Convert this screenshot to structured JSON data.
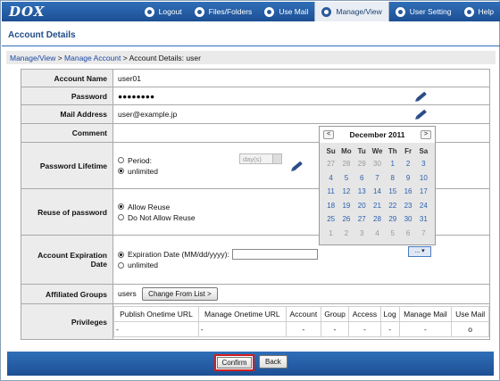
{
  "header": {
    "logo": "DOX",
    "nav": [
      {
        "label": "Logout",
        "icon": "logout-icon"
      },
      {
        "label": "Files/Folders",
        "icon": "folder-icon"
      },
      {
        "label": "Use Mail",
        "icon": "mail-icon"
      },
      {
        "label": "Manage/View",
        "icon": "manage-icon",
        "active": true
      },
      {
        "label": "User Setting",
        "icon": "user-icon"
      },
      {
        "label": "Help",
        "icon": "help-icon"
      }
    ]
  },
  "page": {
    "title": "Account Details",
    "breadcrumb": {
      "link1": "Manage/View",
      "sep1": " > ",
      "link2": "Manage Account",
      "sep2": " > ",
      "current": "Account Details: user"
    }
  },
  "form": {
    "account_name": {
      "label": "Account Name",
      "value": "user01"
    },
    "password": {
      "label": "Password",
      "value": "●●●●●●●●"
    },
    "mail_address": {
      "label": "Mail Address",
      "value": "user@example.jp"
    },
    "comment": {
      "label": "Comment",
      "value": ""
    },
    "password_lifetime": {
      "label": "Password Lifetime",
      "option_period": "Period:",
      "option_unlimited": "unlimited",
      "select_value": "day(s)"
    },
    "reuse": {
      "label": "Reuse of password",
      "option_allow": "Allow Reuse",
      "option_deny": "Do Not Allow Reuse"
    },
    "expiration": {
      "label": "Account Expiration Date",
      "option_date": "Expiration Date (MM/dd/yyyy):",
      "option_unlimited": "unlimited",
      "dropdown": "..."
    },
    "groups": {
      "label": "Affiliated Groups",
      "value": "users",
      "button": "Change From List >"
    },
    "privileges": {
      "label": "Privileges",
      "columns": [
        "Publish Onetime URL",
        "Manage Onetime URL",
        "Account",
        "Group",
        "Access",
        "Log",
        "Manage Mail",
        "Use Mail"
      ],
      "values": [
        "-",
        "-",
        "-",
        "-",
        "-",
        "-",
        "-",
        "o"
      ]
    }
  },
  "calendar": {
    "prev": "<",
    "next": ">",
    "title": "December 2011",
    "weekdays": [
      "Su",
      "Mo",
      "Tu",
      "We",
      "Th",
      "Fr",
      "Sa"
    ],
    "weeks": [
      [
        "27",
        "28",
        "29",
        "30",
        "1",
        "2",
        "3"
      ],
      [
        "4",
        "5",
        "6",
        "7",
        "8",
        "9",
        "10"
      ],
      [
        "11",
        "12",
        "13",
        "14",
        "15",
        "16",
        "17"
      ],
      [
        "18",
        "19",
        "20",
        "21",
        "22",
        "23",
        "24"
      ],
      [
        "25",
        "26",
        "27",
        "28",
        "29",
        "30",
        "31"
      ],
      [
        "1",
        "2",
        "3",
        "4",
        "5",
        "6",
        "7"
      ]
    ]
  },
  "footer": {
    "confirm": "Confirm",
    "back": "Back"
  },
  "colors": {
    "header_blue": "#2f6fb8",
    "title_blue": "#1f4b86",
    "highlight_red": "#d21f1f"
  }
}
